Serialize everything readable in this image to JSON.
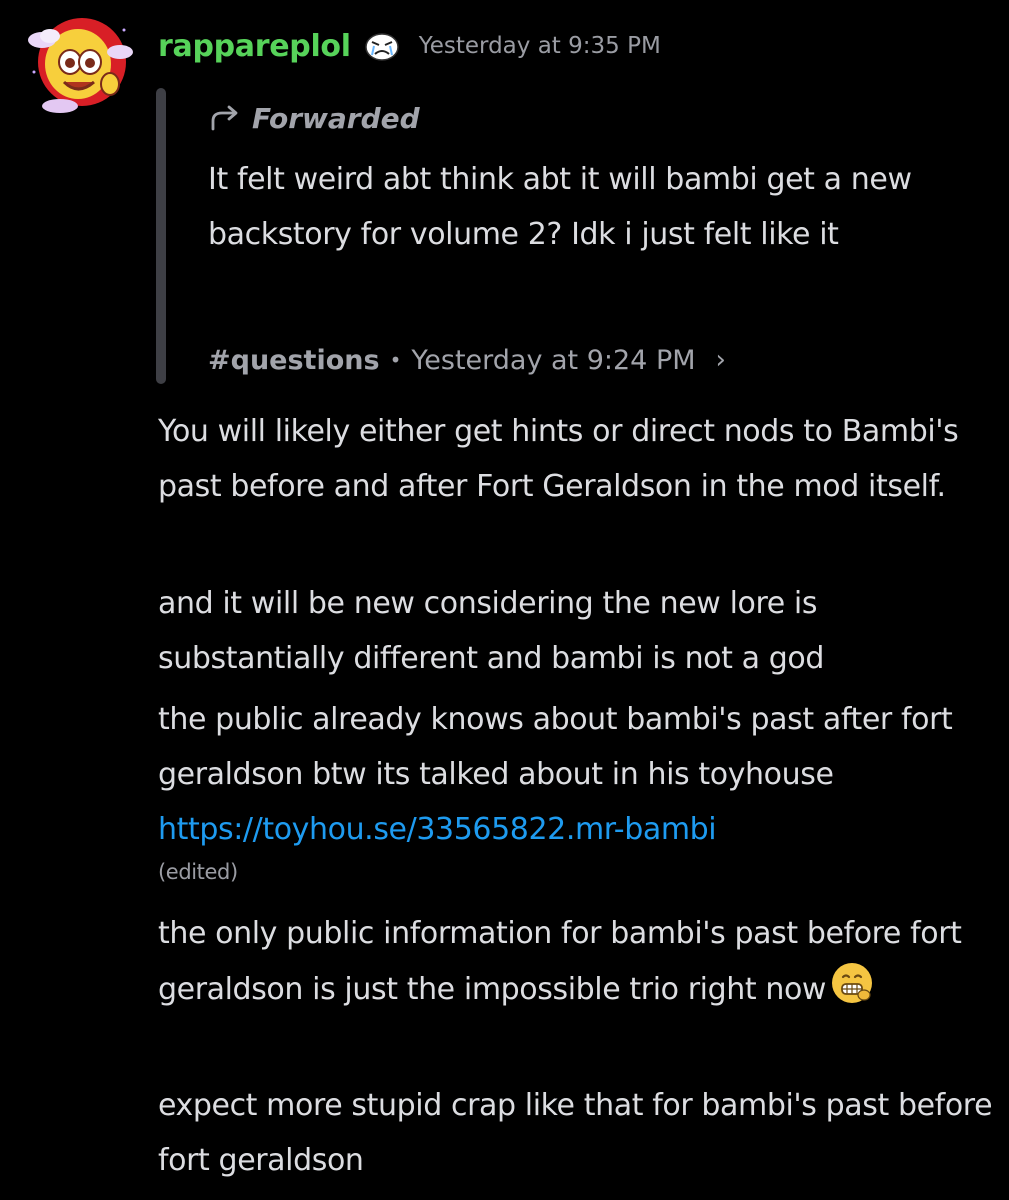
{
  "message": {
    "username": "rappareplol",
    "timestamp": "Yesterday at 9:35 PM",
    "avatar_icon": "yellow-cartoon-character-avatar",
    "badge_icon": "crying-face-badge-icon",
    "username_color": "#57d35a",
    "forward": {
      "label": "Forwarded",
      "text": "It felt weird abt think abt it will bambi get a new backstory for volume 2? Idk i just felt like it",
      "channel": "#questions",
      "timestamp": "Yesterday at 9:24 PM"
    },
    "paragraphs": [
      "You will likely either get hints or direct nods to Bambi's past before and after Fort Geraldson in the mod itself.",
      "and it will be new considering the new lore is substantially different and bambi is not a god"
    ],
    "link_paragraph": {
      "text": "the public already knows about bambi's past after fort geraldson btw its talked about in his toyhouse ",
      "link": "https://toyhou.se/33565822.mr-bambi",
      "edited": "(edited)"
    },
    "emoji_paragraph": {
      "text": "the only public information for bambi's past before fort geraldson is just the impossible trio right now",
      "emoji_icon": "grimacing-emoji-icon"
    },
    "last_paragraph": "expect more stupid crap like that for bambi's past before fort geraldson",
    "link_color": "#1e9bf0"
  }
}
